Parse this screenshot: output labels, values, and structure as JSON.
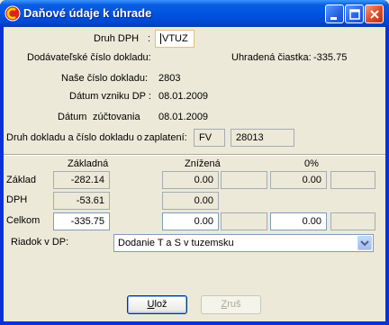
{
  "window": {
    "title": "Daňové údaje k úhrade"
  },
  "header": {
    "druh_dph_label": "Druh DPH",
    "druh_dph_colon": ":",
    "druh_dph_value": "VTUZ",
    "dodavatelske_label": "Dodávateľské číslo dokladu:",
    "uhradena_label": "Uhradená čiastka:",
    "uhradena_value": "-335.75",
    "nase_label": "Naše číslo dokladu:",
    "nase_value": "2803",
    "datum_vzniku_label": "Dátum vzniku DP :",
    "datum_vzniku_value": "08.01.2009",
    "datum_zuctovania_label_1": "Dátum",
    "datum_zuctovania_label_2": "zúčtovania",
    "datum_zuctovania_value": "08.01.2009",
    "druh_dokladu_label_1": "Druh dokladu a číslo dokladu o",
    "druh_dokladu_label_2": "zaplatení:",
    "druh_dokladu_value": "FV",
    "cislo_dokladu_value": "28013"
  },
  "table": {
    "col_zakladna": "Základná",
    "col_znizena": "Znížená",
    "col_zero": "0%",
    "row_zaklad": "Základ",
    "row_dph": "DPH",
    "row_celkom": "Celkom",
    "zaklad_zakladna": "-282.14",
    "zaklad_znizena": "0.00",
    "zaklad_zero": "0.00",
    "dph_zakladna": "-53.61",
    "dph_znizena": "0.00",
    "celkom_zakladna": "-335.75",
    "celkom_znizena": "0.00",
    "celkom_zero": "0.00"
  },
  "riadok": {
    "label": "Riadok v DP:",
    "value": "Dodanie T a S v tuzemsku"
  },
  "buttons": {
    "uloz_label_u": "U",
    "uloz_label_rest": "lož",
    "zrus_label_u": "Z",
    "zrus_label_rest": "ruš"
  },
  "colors": {
    "titlebar": "#0054e3",
    "face": "#ece9d8"
  },
  "icons": {
    "app": "app-logo-icon",
    "minimize": "minimize-icon",
    "maximize": "maximize-icon",
    "close": "close-icon",
    "dropdown": "chevron-down-icon"
  }
}
